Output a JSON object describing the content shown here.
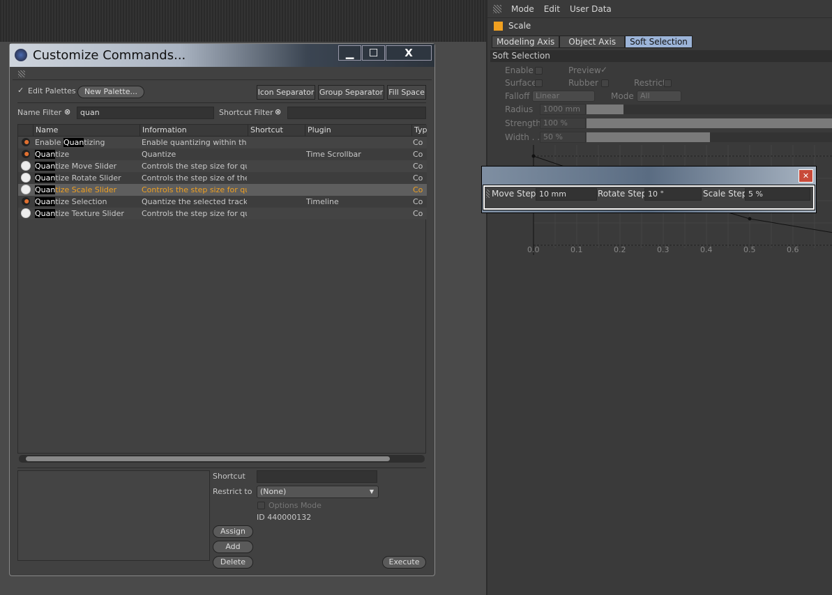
{
  "dialog": {
    "title": "Customize Commands...",
    "min": "▁",
    "max": "☐",
    "close": "X",
    "edit_palettes": "Edit Palettes",
    "new_palette": "New Palette...",
    "icon_sep": "Icon Separator",
    "group_sep": "Group Separator",
    "fill_space": "Fill Space",
    "name_filter_label": "Name Filter",
    "name_filter_value": "quan",
    "shortcut_filter_label": "Shortcut Filter",
    "shortcut_filter_value": "",
    "columns": [
      "Name",
      "Information",
      "Shortcut",
      "Plugin",
      "Typ"
    ],
    "rows": [
      {
        "icon": "timeline-icon",
        "hl": "Quan",
        "name_rest": "tizing",
        "prefix": "Enable ",
        "info": "Enable quantizing within the",
        "plugin": "",
        "type": "Co"
      },
      {
        "icon": "timeline-icon",
        "hl": "Quan",
        "name_rest": "tize",
        "prefix": "",
        "info": "Quantize",
        "plugin": "Time Scrollbar",
        "type": "Co"
      },
      {
        "icon": "gear-icon",
        "hl": "Quan",
        "name_rest": "tize Move Slider",
        "prefix": "",
        "info": "Controls the step size for qu",
        "plugin": "",
        "type": "Co"
      },
      {
        "icon": "gear-icon",
        "hl": "Quan",
        "name_rest": "tize Rotate Slider",
        "prefix": "",
        "info": "Controls the step size of the",
        "plugin": "",
        "type": "Co"
      },
      {
        "icon": "gear-icon",
        "hl": "Quan",
        "name_rest": "tize Scale Slider",
        "prefix": "",
        "info": "Controls the step size for qu",
        "plugin": "",
        "type": "Co",
        "selected": true
      },
      {
        "icon": "timeline-icon",
        "hl": "Quan",
        "name_rest": "tize Selection",
        "prefix": "",
        "info": "Quantize the selected track",
        "plugin": "Timeline",
        "type": "Co"
      },
      {
        "icon": "gear-icon",
        "hl": "Quan",
        "name_rest": "tize Texture Slider",
        "prefix": "",
        "info": "Controls the step size for qu",
        "plugin": "",
        "type": "Co"
      }
    ],
    "shortcut_label": "Shortcut",
    "shortcut_value": "",
    "restrict_label": "Restrict to",
    "restrict_value": "(None)",
    "options_mode": "Options Mode",
    "id": "ID 440000132",
    "assign": "Assign",
    "add": "Add",
    "delete": "Delete",
    "execute": "Execute",
    "selected_color": "#f0a020"
  },
  "attr": {
    "menu": [
      "Mode",
      "Edit",
      "User Data"
    ],
    "tool": "Scale",
    "tabs": [
      "Modeling Axis",
      "Object Axis",
      "Soft Selection"
    ],
    "active_tab": "Soft Selection",
    "section": "Soft Selection",
    "enable": "Enable",
    "preview": "Preview",
    "surface": "Surface",
    "rubber": "Rubber",
    "restrict": "Restrict",
    "falloff": "Falloff",
    "falloff_value": "Linear",
    "mode": "Mode",
    "mode_value": "All",
    "radius": "Radius",
    "radius_value": "1000 mm",
    "strength": "Strength",
    "strength_value": "100 %",
    "width": "Width . .",
    "width_value": "50 %",
    "strength_fill": 1.0,
    "width_fill": 0.5,
    "radius_fill": 0.15,
    "graph_ticks": [
      "0.0",
      "0.1",
      "0.2",
      "0.3",
      "0.4",
      "0.5",
      "0.6"
    ]
  },
  "quantize": {
    "move_label": "Move Step",
    "move_value": "10 mm",
    "rotate_label": "Rotate Step",
    "rotate_value": "10 °",
    "scale_label": "Scale Step",
    "scale_value": "5 %",
    "close": "✕"
  }
}
